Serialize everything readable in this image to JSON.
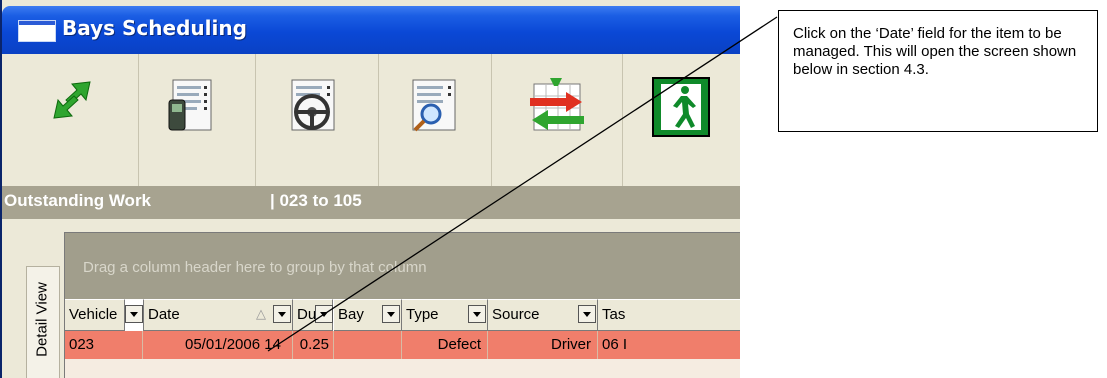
{
  "window": {
    "title": "Bays Scheduling"
  },
  "toolbar": {
    "buttons": [
      {
        "icon": "refresh-arrows-icon"
      },
      {
        "icon": "phone-list-icon"
      },
      {
        "icon": "steering-wheel-list-icon"
      },
      {
        "icon": "search-list-icon"
      },
      {
        "icon": "transfer-tools-icon"
      },
      {
        "icon": "exit-door-icon"
      }
    ]
  },
  "section": {
    "title": "Outstanding Work",
    "range": "| 023 to 105"
  },
  "side_tab": {
    "label": "Detail View"
  },
  "grid": {
    "group_prompt": "Drag a column header here to group by that column",
    "columns": [
      "Vehicle",
      "Date",
      "Dur",
      "Bay",
      "Type",
      "Source",
      "Tas"
    ],
    "rows": [
      {
        "vehicle": "023",
        "date": "05/01/2006 14",
        "dur": "0.25",
        "bay": "",
        "type": "Defect",
        "source": "Driver",
        "task": "06 I"
      }
    ],
    "row_color": "#f07e6b"
  },
  "callout": {
    "text": "Click on the ‘Date’ field for the item to be managed.  This will open the screen shown below in section 4.3."
  },
  "colors": {
    "title_bar": "#0a48d6",
    "section_bar": "#a7a390",
    "group_panel": "#a19e8c"
  }
}
